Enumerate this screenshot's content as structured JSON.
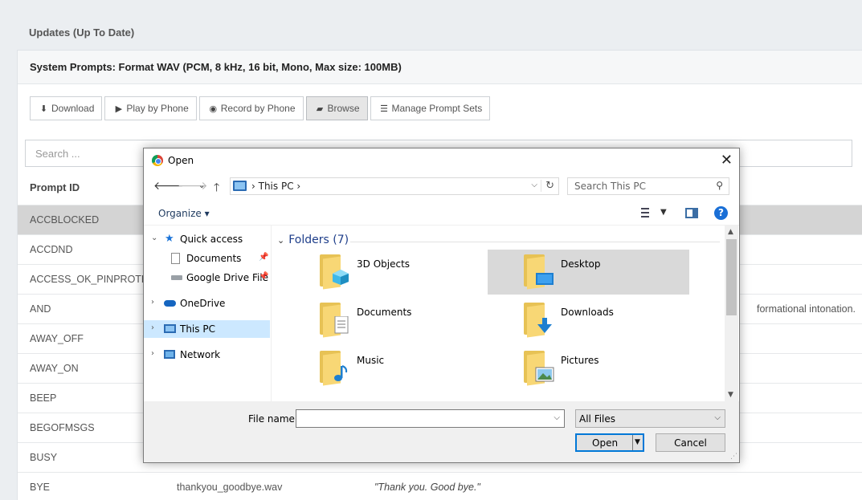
{
  "page": {
    "section_title": "Updates (Up To Date)",
    "panel_title": "System Prompts: Format WAV (PCM, 8 kHz, 16 bit, Mono, Max size: 100MB)",
    "toolbar": {
      "download": "Download",
      "play_by_phone": "Play by Phone",
      "record_by_phone": "Record by Phone",
      "browse": "Browse",
      "manage_prompt_sets": "Manage Prompt Sets"
    },
    "search_placeholder": "Search ...",
    "column_prompt_id": "Prompt ID",
    "rows": [
      {
        "id": "ACCBLOCKED"
      },
      {
        "id": "ACCDND"
      },
      {
        "id": "ACCESS_OK_PINPROTECTED"
      },
      {
        "id": "AND",
        "desc_tail": "formational intonation."
      },
      {
        "id": "AWAY_OFF"
      },
      {
        "id": "AWAY_ON"
      },
      {
        "id": "BEEP"
      },
      {
        "id": "BEGOFMSGS"
      },
      {
        "id": "BUSY"
      },
      {
        "id": "BYE",
        "file": "thankyou_goodbye.wav",
        "desc": "\"Thank you. Good bye.\""
      }
    ]
  },
  "dialog": {
    "title": "Open",
    "close_glyph": "✕",
    "address": {
      "crumb": "This PC"
    },
    "search_placeholder": "Search This PC",
    "organize": "Organize ▾",
    "nav": {
      "quick_access": "Quick access",
      "documents": "Documents",
      "google_drive": "Google Drive File",
      "onedrive": "OneDrive",
      "this_pc": "This PC",
      "network": "Network"
    },
    "group_label": "Folders (7)",
    "folders": {
      "objects3d": "3D Objects",
      "desktop": "Desktop",
      "documents": "Documents",
      "downloads": "Downloads",
      "music": "Music",
      "pictures": "Pictures"
    },
    "file_name_label": "File name:",
    "file_name_value": "",
    "file_type": "All Files",
    "open_button": "Open",
    "cancel_button": "Cancel"
  }
}
